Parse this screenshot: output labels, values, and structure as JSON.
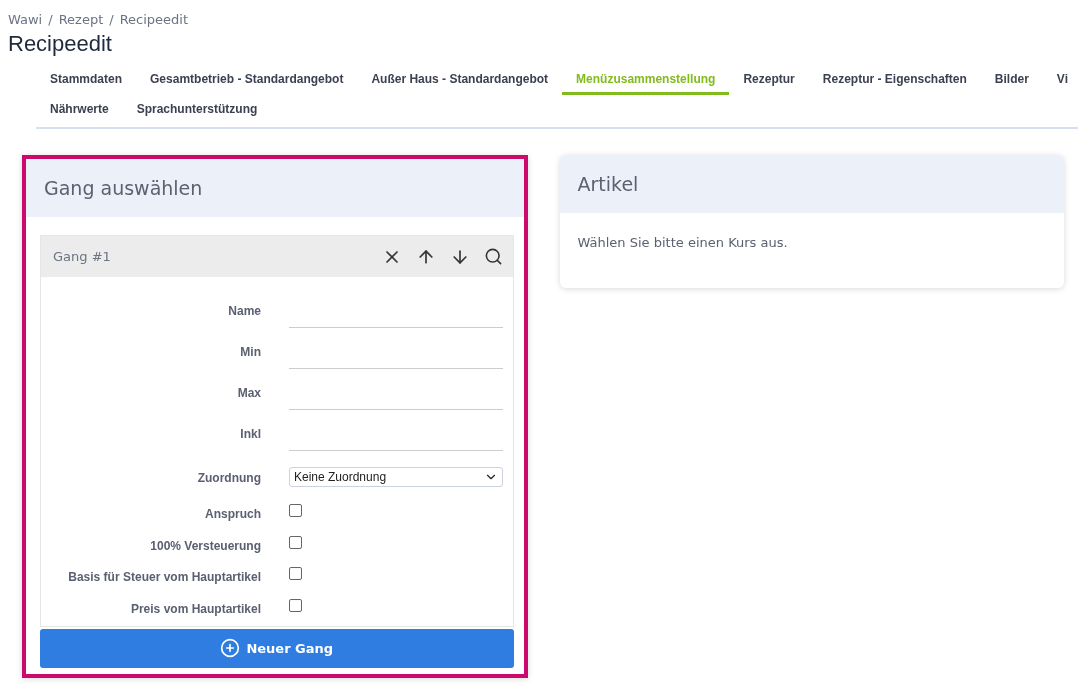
{
  "breadcrumb": [
    "Wawi",
    "Rezept",
    "Recipeedit"
  ],
  "breadcrumb_separator": "/",
  "title": "Recipeedit",
  "tab_rows": [
    [
      {
        "label": "Stammdaten",
        "selected": false
      },
      {
        "label": "Gesamtbetrieb - Standardangebot",
        "selected": false
      },
      {
        "label": "Außer Haus - Standardangebot",
        "selected": false
      },
      {
        "label": "Menüzusammenstellung",
        "selected": true
      },
      {
        "label": "Rezeptur",
        "selected": false
      },
      {
        "label": "Rezeptur - Eigenschaften",
        "selected": false
      },
      {
        "label": "Bilder",
        "selected": false
      },
      {
        "label": "Vi",
        "selected": false
      }
    ],
    [
      {
        "label": "Nährwerte",
        "selected": false
      },
      {
        "label": "Sprachunterstützung",
        "selected": false
      }
    ]
  ],
  "course_card": {
    "title": "Gang auswählen",
    "highlighted": true,
    "course": {
      "title": "Gang #1",
      "fields": [
        {
          "kind": "text",
          "label": "Name"
        },
        {
          "kind": "text",
          "label": "Min"
        },
        {
          "kind": "text",
          "label": "Max"
        },
        {
          "kind": "text",
          "label": "Inkl"
        },
        {
          "kind": "select",
          "label": "Zuordnung",
          "value": "Keine Zuordnung"
        },
        {
          "kind": "checkbox",
          "label": "Anspruch",
          "checked": false
        },
        {
          "kind": "checkbox",
          "label": "100% Versteuerung",
          "checked": false
        },
        {
          "kind": "checkbox",
          "label": "Basis für Steuer vom Hauptartikel",
          "checked": false
        },
        {
          "kind": "checkbox",
          "label": "Preis vom Hauptartikel",
          "checked": false
        }
      ]
    },
    "button": "Neuer Gang"
  },
  "article_card": {
    "title": "Artikel",
    "message": "Wählen Sie bitte einen Kurs aus."
  }
}
